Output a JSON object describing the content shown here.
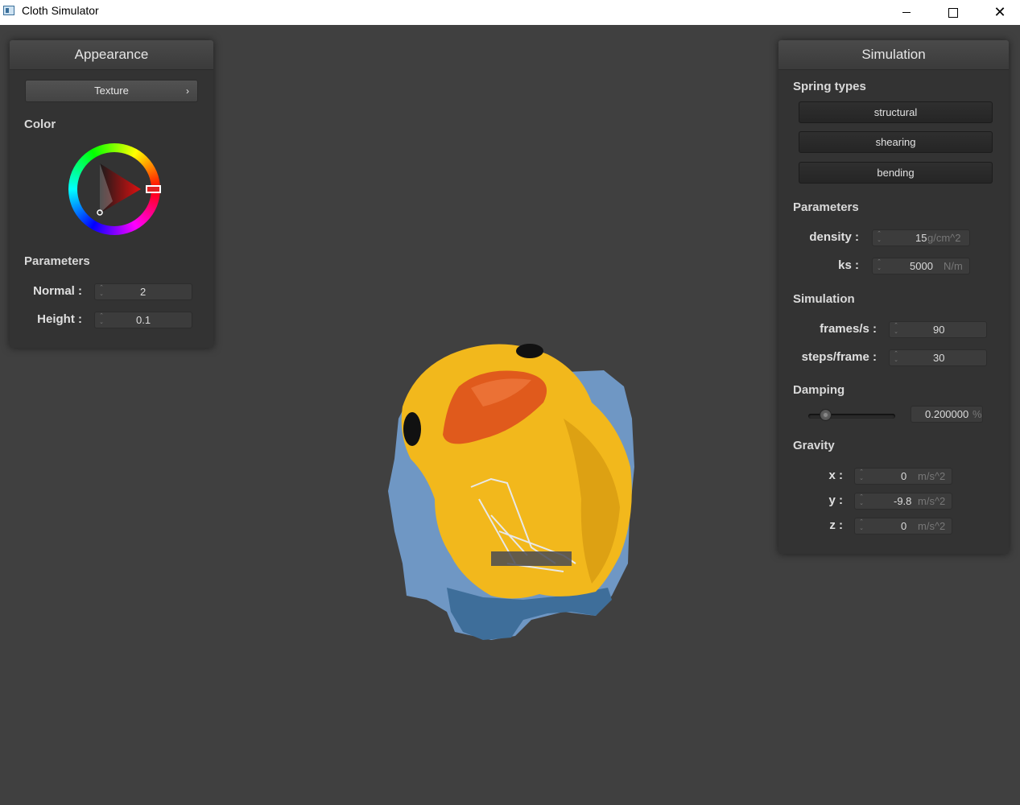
{
  "window": {
    "title": "Cloth Simulator"
  },
  "appearance": {
    "title": "Appearance",
    "shader_button": "Texture",
    "shader_chevron": "›",
    "color_label": "Color",
    "params_label": "Parameters",
    "normal_label": "Normal :",
    "normal_value": "2",
    "height_label": "Height :",
    "height_value": "0.1"
  },
  "simulation": {
    "title": "Simulation",
    "spring_label": "Spring types",
    "structural": "structural",
    "shearing": "shearing",
    "bending": "bending",
    "params_label": "Parameters",
    "density_label": "density :",
    "density_value": "15",
    "density_unit": "g/cm^2",
    "ks_label": "ks :",
    "ks_value": "5000",
    "ks_unit": "N/m",
    "sim_label": "Simulation",
    "fps_label": "frames/s :",
    "fps_value": "90",
    "steps_label": "steps/frame :",
    "steps_value": "30",
    "damping_label": "Damping",
    "damping_value": "0.200000",
    "damping_unit": "%",
    "damping_level": 0.2,
    "gravity_label": "Gravity",
    "gx_label": "x :",
    "gx_value": "0",
    "gy_label": "y :",
    "gy_value": "-9.8",
    "gz_label": "z :",
    "gz_value": "0",
    "g_unit": "m/s^2"
  },
  "colors": {
    "background": "#404040",
    "panel": "#333333",
    "duck_yellow": "#f2b81c",
    "beak": "#e05a1c"
  }
}
